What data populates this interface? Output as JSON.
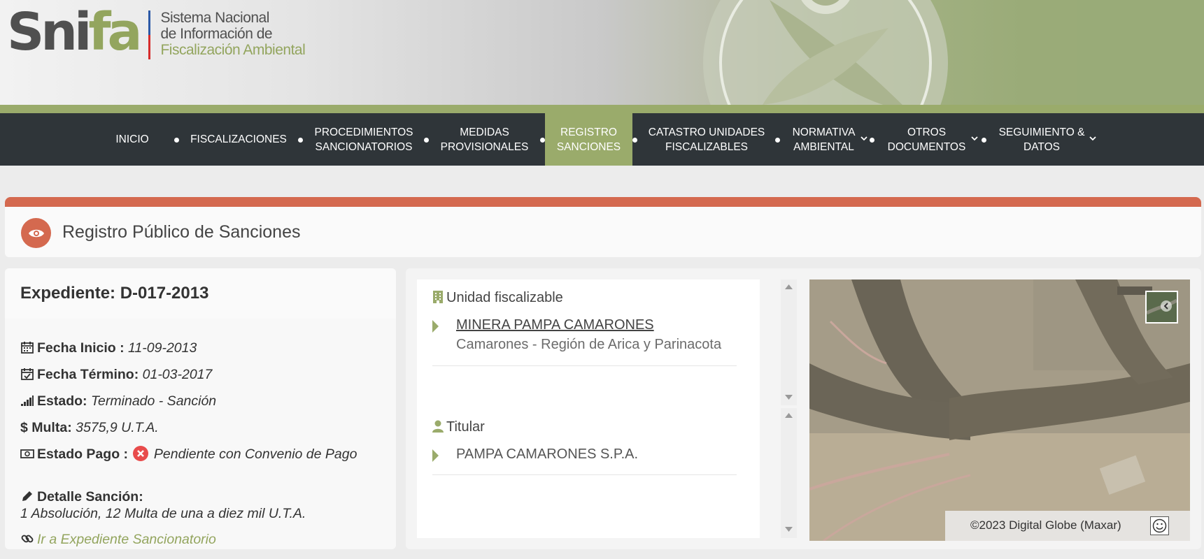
{
  "header": {
    "logo_sni": "Sni",
    "logo_fa": "fa",
    "logo_line1": "Sistema Nacional",
    "logo_line2": "de Información de",
    "logo_line3": "Fiscalización Ambiental"
  },
  "nav": {
    "items": [
      {
        "label": "INICIO"
      },
      {
        "label": "FISCALIZACIONES"
      },
      {
        "label": "PROCEDIMIENTOS SANCIONATORIOS"
      },
      {
        "label": "MEDIDAS PROVISIONALES"
      },
      {
        "label": "REGISTRO SANCIONES"
      },
      {
        "label": "CATASTRO UNIDADES FISCALIZABLES"
      },
      {
        "label": "NORMATIVA AMBIENTAL"
      },
      {
        "label": "OTROS DOCUMENTOS"
      },
      {
        "label": "SEGUIMIENTO & DATOS"
      }
    ],
    "active_index": 4
  },
  "page": {
    "title": "Registro Público de Sanciones"
  },
  "expediente": {
    "title": "Expediente: D-017-2013",
    "fecha_inicio_label": "Fecha Inicio :",
    "fecha_inicio_value": "11-09-2013",
    "fecha_termino_label": "Fecha Término:",
    "fecha_termino_value": "01-03-2017",
    "estado_label": "Estado:",
    "estado_value": "Terminado - Sanción",
    "multa_label": "Multa:",
    "multa_value": "3575,9 U.T.A.",
    "estado_pago_label": "Estado Pago :",
    "estado_pago_value": "Pendiente con Convenio de Pago",
    "detalle_label": "Detalle Sanción:",
    "detalle_value": "1 Absolución, 12 Multa de una a diez mil U.T.A.",
    "link_label": "Ir a Expediente Sancionatorio"
  },
  "unidad": {
    "title": "Unidad fiscalizable",
    "name": "MINERA PAMPA CAMARONES",
    "location": "Camarones - Región de Arica y Parinacota"
  },
  "titular": {
    "title": "Titular",
    "name": "PAMPA CAMARONES S.P.A."
  },
  "map": {
    "credit": "©2023 Digital Globe (Maxar)"
  },
  "colors": {
    "accent_green": "#9aab6b",
    "accent_orange": "#d4694f",
    "nav_bg": "#2f3539",
    "error_red": "#e84b4b"
  }
}
